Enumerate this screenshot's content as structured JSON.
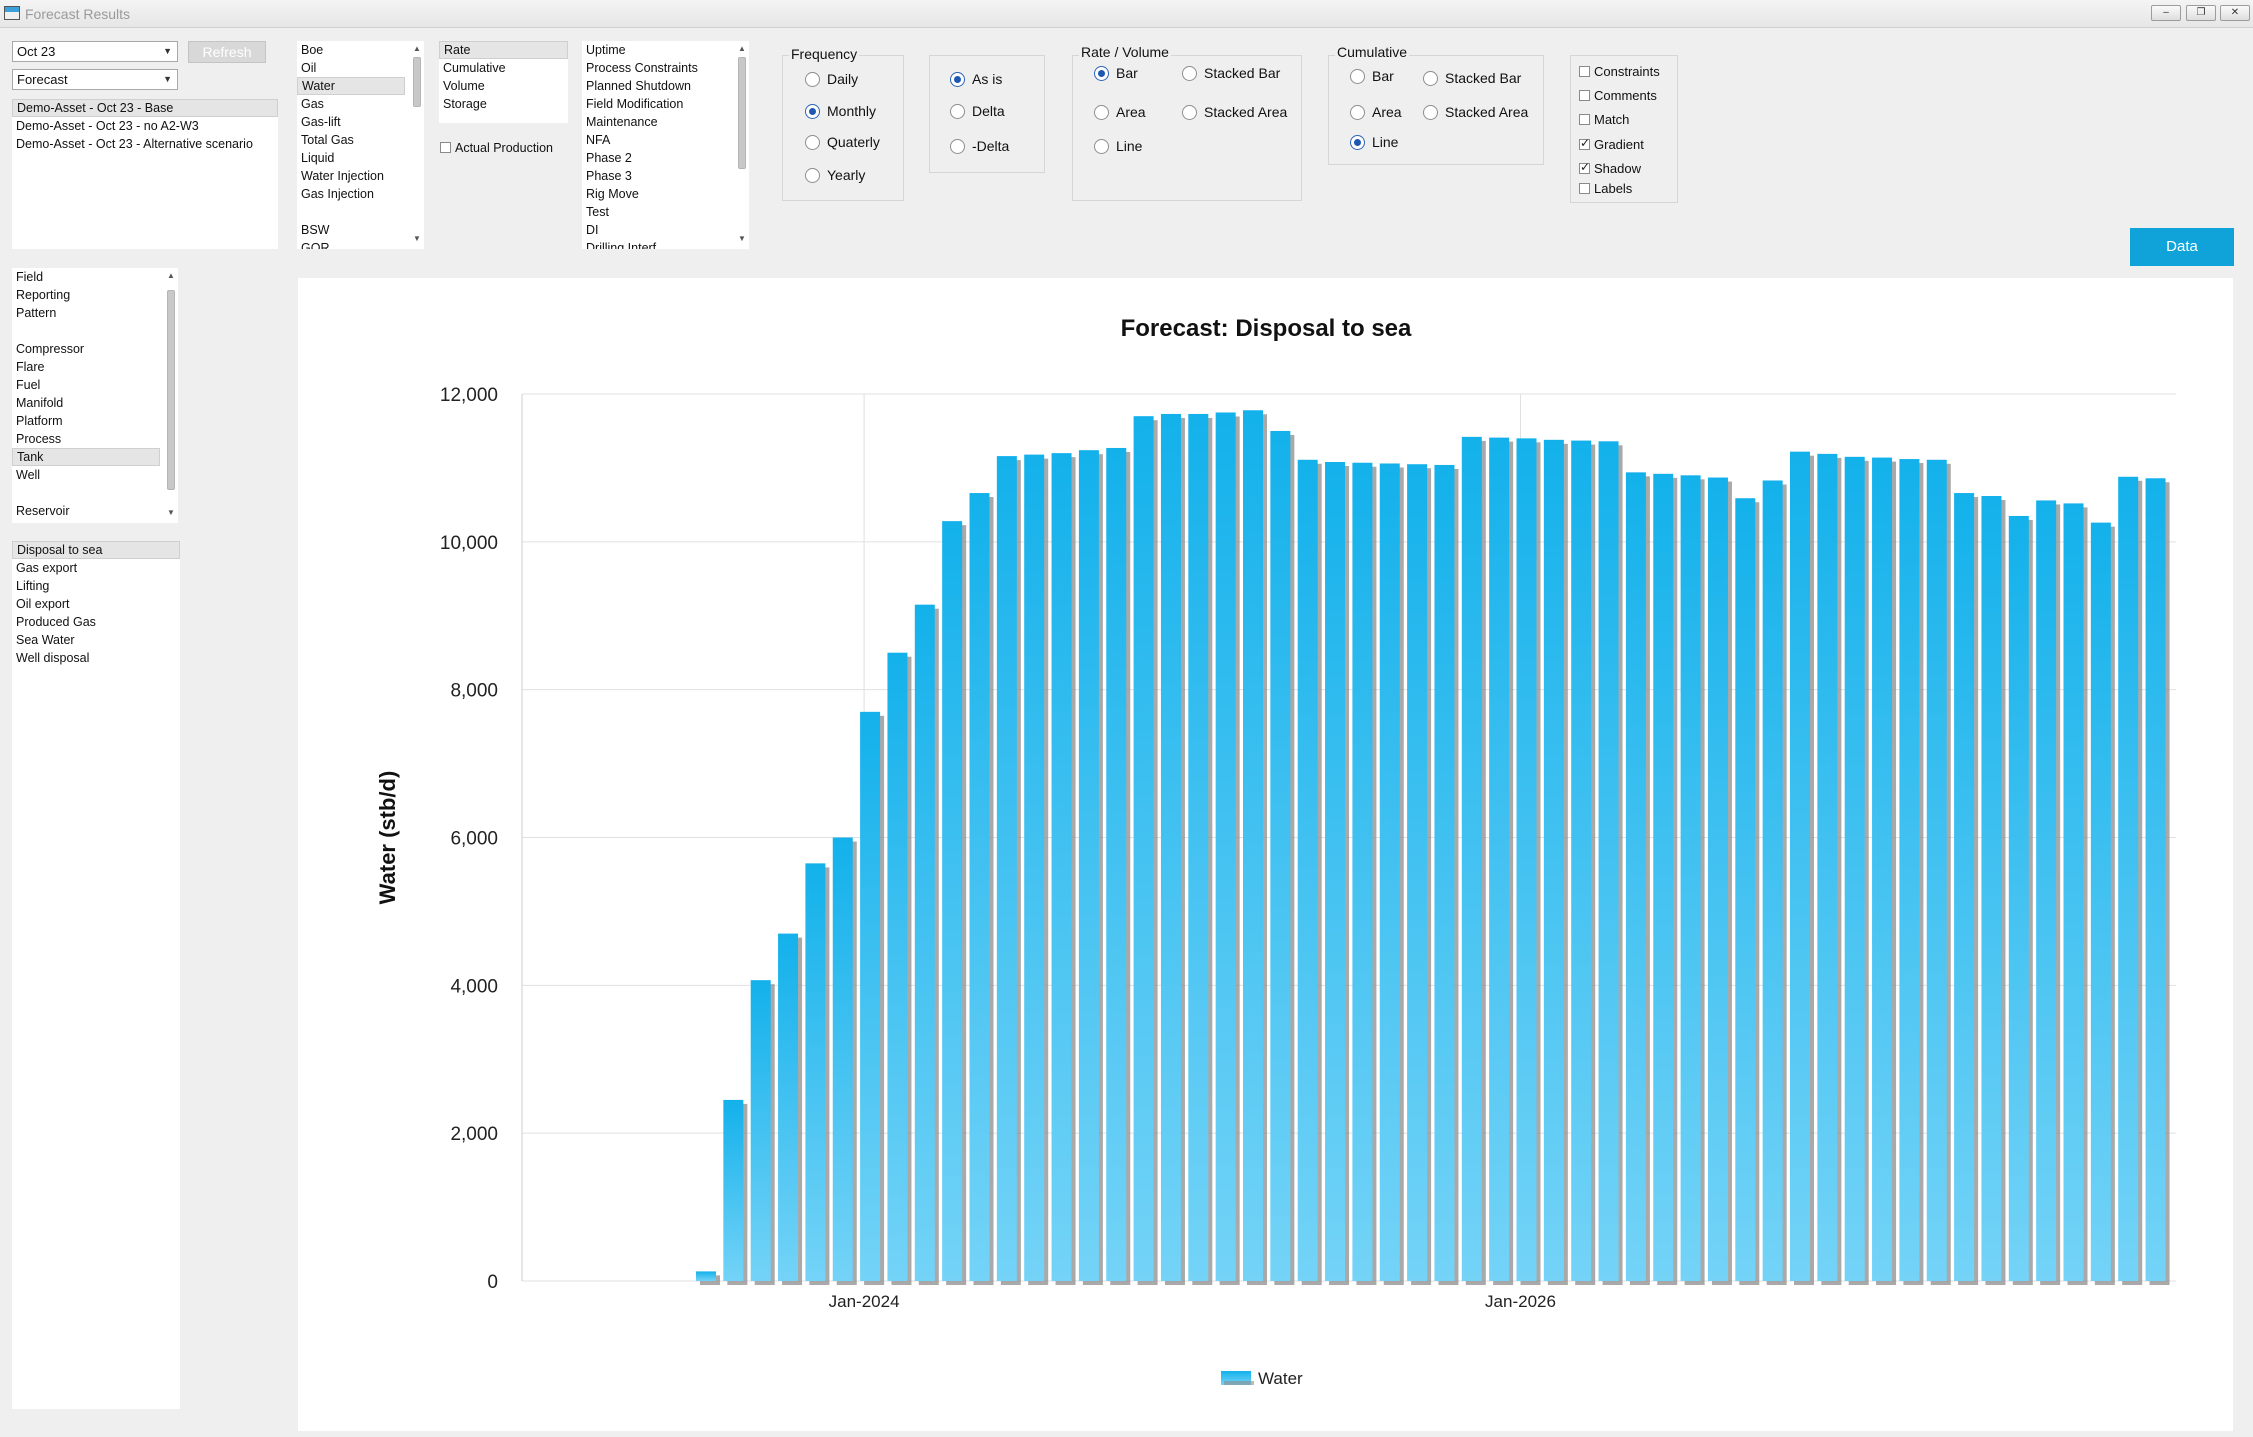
{
  "window": {
    "title": "Forecast Results",
    "buttons": [
      "–",
      "❐",
      "✕"
    ]
  },
  "toolbar": {
    "period_value": "Oct 23",
    "type_value": "Forecast",
    "refresh_label": "Refresh",
    "data_button": "Data"
  },
  "scenarios": [
    "Demo-Asset - Oct 23 - Base",
    "Demo-Asset - Oct 23 - no A2-W3",
    "Demo-Asset - Oct 23 - Alternative scenario"
  ],
  "fluids": [
    "Boe",
    "Oil",
    "Water",
    "Gas",
    "Gas-lift",
    "Total Gas",
    "Liquid",
    "Water Injection",
    "Gas Injection",
    "",
    "BSW",
    "GOR"
  ],
  "fluid_selected": 2,
  "measures": [
    "Rate",
    "Cumulative",
    "Volume",
    "Storage"
  ],
  "measure_selected": 0,
  "actual_production_label": "Actual Production",
  "constraints": [
    "Uptime",
    "Process Constraints",
    "Planned Shutdown",
    "Field Modification",
    "Maintenance",
    "NFA",
    "Phase 2",
    "Phase 3",
    "Rig Move",
    "Test",
    "DI",
    "Drilling Interf"
  ],
  "frequency": {
    "title": "Frequency",
    "options": [
      "Daily",
      "Monthly",
      "Quaterly",
      "Yearly"
    ],
    "selected": 1
  },
  "delta": {
    "options": [
      "As is",
      "Delta",
      "-Delta"
    ],
    "selected": 0
  },
  "rate_volume": {
    "title": "Rate / Volume",
    "col1": [
      "Bar",
      "Area",
      "Line"
    ],
    "col2": [
      "Stacked Bar",
      "Stacked Area"
    ],
    "selected": "Bar"
  },
  "cumulative": {
    "title": "Cumulative",
    "col1": [
      "Bar",
      "Area",
      "Line"
    ],
    "col2": [
      "Stacked Bar",
      "Stacked Area"
    ],
    "selected": "Line"
  },
  "options": [
    {
      "label": "Constraints",
      "checked": false
    },
    {
      "label": "Comments",
      "checked": false
    },
    {
      "label": "Match",
      "checked": false
    },
    {
      "label": "Gradient",
      "checked": true
    },
    {
      "label": "Shadow",
      "checked": true
    },
    {
      "label": "Labels",
      "checked": false
    }
  ],
  "hierarchy": [
    "Field",
    "Reporting",
    "Pattern",
    "",
    "Compressor",
    "Flare",
    "Fuel",
    "Manifold",
    "Platform",
    "Process",
    "Tank",
    "Well",
    "",
    "Reservoir"
  ],
  "hierarchy_selected": 10,
  "tanks": [
    "Disposal to sea",
    "Gas export",
    "Lifting",
    "Oil export",
    "Produced Gas",
    "Sea Water",
    "Well disposal"
  ],
  "tank_selected": 0,
  "chart_data": {
    "type": "bar",
    "title": "Forecast:  Disposal to sea",
    "ylabel": "Water (stb/d)",
    "xlabel": "",
    "ylim": [
      0,
      12000
    ],
    "yticks": [
      0,
      2000,
      4000,
      6000,
      8000,
      10000,
      12000
    ],
    "ytick_labels": [
      "0",
      "2,000",
      "4,000",
      "6,000",
      "8,000",
      "10,000",
      "12,000"
    ],
    "xtick_labels": [
      {
        "label": "Jan-2024",
        "index": 6
      },
      {
        "label": "Jan-2026",
        "index": 30
      }
    ],
    "categories": [
      "Jul-2023",
      "Aug-2023",
      "Sep-2023",
      "Oct-2023",
      "Nov-2023",
      "Dec-2023",
      "Jan-2024",
      "Feb-2024",
      "Mar-2024",
      "Apr-2024",
      "May-2024",
      "Jun-2024",
      "Jul-2024",
      "Aug-2024",
      "Sep-2024",
      "Oct-2024",
      "Nov-2024",
      "Dec-2024",
      "Jan-2025",
      "Feb-2025",
      "Mar-2025",
      "Apr-2025",
      "May-2025",
      "Jun-2025",
      "Jul-2025",
      "Aug-2025",
      "Sep-2025",
      "Oct-2025",
      "Nov-2025",
      "Dec-2025",
      "Jan-2026",
      "Feb-2026",
      "Mar-2026",
      "Apr-2026",
      "May-2026",
      "Jun-2026",
      "Jul-2026",
      "Aug-2026",
      "Sep-2026",
      "Oct-2026",
      "Nov-2026",
      "Dec-2026",
      "Jan-2027",
      "Feb-2027",
      "Mar-2027",
      "Apr-2027",
      "May-2027",
      "Jun-2027",
      "Jul-2027",
      "Aug-2027",
      "Sep-2027",
      "Oct-2027",
      "Nov-2027",
      "Dec-2027"
    ],
    "series": [
      {
        "name": "Water",
        "color": "#19b4ec",
        "values": [
          130,
          2450,
          4070,
          4700,
          5650,
          6000,
          7700,
          8500,
          9150,
          10280,
          10660,
          11160,
          11180,
          11200,
          11240,
          11270,
          11700,
          11730,
          11730,
          11750,
          11780,
          11500,
          11110,
          11080,
          11070,
          11060,
          11050,
          11040,
          11420,
          11410,
          11400,
          11380,
          11370,
          11360,
          10940,
          10920,
          10900,
          10870,
          10590,
          10830,
          11220,
          11190,
          11150,
          11140,
          11120,
          11110,
          10660,
          10620,
          10350,
          10560,
          10520,
          10260,
          10880,
          10860
        ]
      }
    ],
    "legend": "bottom-center",
    "grid": true
  }
}
